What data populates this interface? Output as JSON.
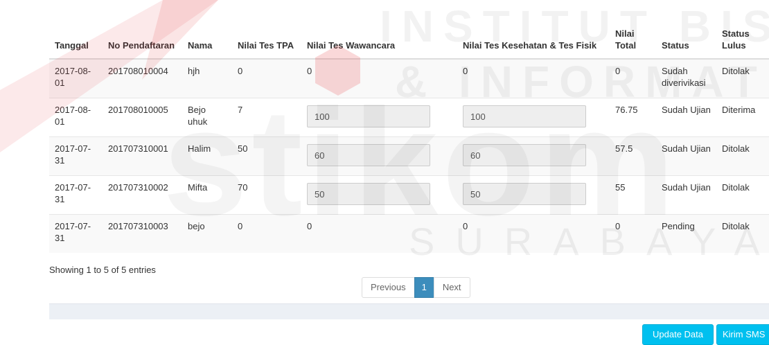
{
  "watermark": {
    "line1": "INSTITUT BISNIS",
    "line2": "& INFORMATIKA",
    "brand": "stikom",
    "city": "SURABAYA"
  },
  "table": {
    "headers": [
      "Tanggal",
      "No Pendaftaran",
      "Nama",
      "Nilai Tes TPA",
      "Nilai Tes Wawancara",
      "Nilai Tes Kesehatan & Tes Fisik",
      "Nilai Total",
      "Status",
      "Status Lulus"
    ],
    "rows": [
      {
        "tanggal": "2017-08-01",
        "no": "201708010004",
        "nama": "hjh",
        "tpa": "0",
        "wawancara": "0",
        "kesehatan": "0",
        "total": "0",
        "status": "Sudah diverivikasi",
        "lulus": "Ditolak"
      },
      {
        "tanggal": "2017-08-01",
        "no": "201708010005",
        "nama": "Bejo uhuk",
        "tpa": "7",
        "wawancara": "100",
        "kesehatan": "100",
        "total": "76.75",
        "status": "Sudah Ujian",
        "lulus": "Diterima"
      },
      {
        "tanggal": "2017-07-31",
        "no": "201707310001",
        "nama": "Halim",
        "tpa": "50",
        "wawancara": "60",
        "kesehatan": "60",
        "total": "57.5",
        "status": "Sudah Ujian",
        "lulus": "Ditolak"
      },
      {
        "tanggal": "2017-07-31",
        "no": "201707310002",
        "nama": "Mifta",
        "tpa": "70",
        "wawancara": "50",
        "kesehatan": "50",
        "total": "55",
        "status": "Sudah Ujian",
        "lulus": "Ditolak"
      },
      {
        "tanggal": "2017-07-31",
        "no": "201707310003",
        "nama": "bejo",
        "tpa": "0",
        "wawancara": "0",
        "kesehatan": "0",
        "total": "0",
        "status": "Pending",
        "lulus": "Ditolak"
      }
    ]
  },
  "info_text": "Showing 1 to 5 of 5 entries",
  "pagination": {
    "previous": "Previous",
    "page": "1",
    "next": "Next"
  },
  "buttons": {
    "update": "Update Data",
    "sms": "Kirim SMS"
  },
  "colors": {
    "primary": "#3c8dbc",
    "info_button": "#00c0ef"
  }
}
